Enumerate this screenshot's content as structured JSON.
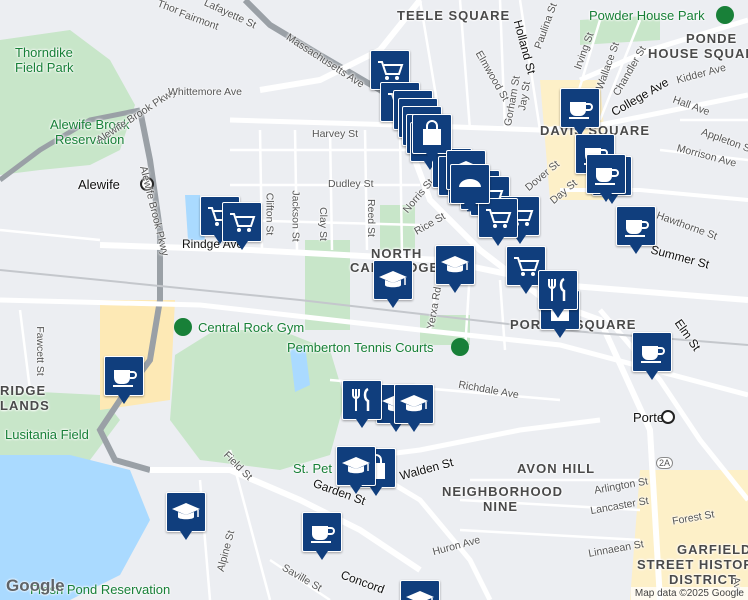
{
  "map": {
    "attribution": "Map data ©2025 Google",
    "logo": "Google",
    "colors": {
      "road": "#ffffff",
      "water": "#aadaff",
      "park": "#c8e6c9",
      "highway": "#9aa0a6",
      "pin": "#103e7d"
    }
  },
  "areas": [
    {
      "id": "teele",
      "text": "TEELE SQUARE"
    },
    {
      "id": "davis",
      "text": "DAVIS SQUARE"
    },
    {
      "id": "north",
      "text": "NORTH"
    },
    {
      "id": "cambridge",
      "text": "CAMBRIDGE"
    },
    {
      "id": "porter",
      "text": "PORTER SQUARE"
    },
    {
      "id": "avon",
      "text": "AVON HILL"
    },
    {
      "id": "neigh1",
      "text": "NEIGHBORHOOD"
    },
    {
      "id": "neigh2",
      "text": "NINE"
    },
    {
      "id": "garfield1",
      "text": "GARFIELD"
    },
    {
      "id": "garfield2",
      "text": "STREET HISTORIC"
    },
    {
      "id": "garfield3",
      "text": "DISTRICT"
    },
    {
      "id": "ponder1",
      "text": "PONDE"
    },
    {
      "id": "ponder2",
      "text": "HOUSE SQUARE"
    },
    {
      "id": "cridge",
      "text": "RIDGE"
    },
    {
      "id": "clands",
      "text": "LANDS"
    }
  ],
  "pois": [
    {
      "id": "thorndike1",
      "text": "Thorndike"
    },
    {
      "id": "thorndike2",
      "text": "Field Park"
    },
    {
      "id": "alewife_res1",
      "text": "Alewife Brook"
    },
    {
      "id": "alewife_res2",
      "text": "Reservation"
    },
    {
      "id": "alewife",
      "text": "Alewife"
    },
    {
      "id": "powder",
      "text": "Powder House Park"
    },
    {
      "id": "rock",
      "text": "Central Rock Gym"
    },
    {
      "id": "tennis",
      "text": "Pemberton Tennis Courts"
    },
    {
      "id": "lusitania",
      "text": "Lusitania Field"
    },
    {
      "id": "stpeter",
      "text": "St. Pet"
    },
    {
      "id": "porterT",
      "text": "Porter"
    },
    {
      "id": "fresh",
      "text": "Fresh Pond Reservation"
    }
  ],
  "streets": [
    {
      "id": "s1",
      "text": "Massachusetts Ave"
    },
    {
      "id": "s2",
      "text": "Alewife Brook Pkwy"
    },
    {
      "id": "s3",
      "text": "Whittemore Ave"
    },
    {
      "id": "s4",
      "text": "Harvey St"
    },
    {
      "id": "s5",
      "text": "Dudley St"
    },
    {
      "id": "s6",
      "text": "Rindge Ave"
    },
    {
      "id": "s7",
      "text": "Clifton St"
    },
    {
      "id": "s8",
      "text": "Jackson St"
    },
    {
      "id": "s9",
      "text": "Clay St"
    },
    {
      "id": "s10",
      "text": "Reed St"
    },
    {
      "id": "s11",
      "text": "Norris St"
    },
    {
      "id": "s12",
      "text": "Rice St"
    },
    {
      "id": "s13",
      "text": "Yerxa Rd"
    },
    {
      "id": "s14",
      "text": "Richdale Ave"
    },
    {
      "id": "s15",
      "text": "Walden St"
    },
    {
      "id": "s16",
      "text": "Garden St"
    },
    {
      "id": "s17",
      "text": "Field St"
    },
    {
      "id": "s18",
      "text": "Alpine St"
    },
    {
      "id": "s19",
      "text": "Saville St"
    },
    {
      "id": "s20",
      "text": "Concord"
    },
    {
      "id": "s21",
      "text": "Huron Ave"
    },
    {
      "id": "s22",
      "text": "Arlington St"
    },
    {
      "id": "s23",
      "text": "Lancaster St"
    },
    {
      "id": "s24",
      "text": "Forest St"
    },
    {
      "id": "s25",
      "text": "Linnaean St"
    },
    {
      "id": "s26",
      "text": "Elm St"
    },
    {
      "id": "s27",
      "text": "Holland St"
    },
    {
      "id": "s28",
      "text": "Elmwood St"
    },
    {
      "id": "s29",
      "text": "Gorham St"
    },
    {
      "id": "s30",
      "text": "Jay St"
    },
    {
      "id": "s31",
      "text": "Paulina St"
    },
    {
      "id": "s32",
      "text": "Irving St"
    },
    {
      "id": "s33",
      "text": "Wallace St"
    },
    {
      "id": "s34",
      "text": "Chandler St"
    },
    {
      "id": "s35",
      "text": "College Ave"
    },
    {
      "id": "s36",
      "text": "Kidder Ave"
    },
    {
      "id": "s37",
      "text": "Hall Ave"
    },
    {
      "id": "s38",
      "text": "Morrison Ave"
    },
    {
      "id": "s39",
      "text": "Appleton St"
    },
    {
      "id": "s40",
      "text": "Hawthorne St"
    },
    {
      "id": "s41",
      "text": "Dover St"
    },
    {
      "id": "s42",
      "text": "Day St"
    },
    {
      "id": "s43",
      "text": "Fawcett St"
    },
    {
      "id": "s44",
      "text": "Lafayette St"
    },
    {
      "id": "s45",
      "text": "Fairmont"
    },
    {
      "id": "s46",
      "text": "Thor"
    },
    {
      "id": "s47",
      "text": "Ave"
    },
    {
      "id": "s48",
      "text": "Summer St"
    }
  ],
  "route_shield": "2A",
  "markers": [
    {
      "type": "cart"
    },
    {
      "type": "cart"
    },
    {
      "type": "cart"
    },
    {
      "type": "cart"
    },
    {
      "type": "cart"
    },
    {
      "type": "cart"
    },
    {
      "type": "cart"
    },
    {
      "type": "cart"
    },
    {
      "type": "cart"
    },
    {
      "type": "cart"
    },
    {
      "type": "cart"
    },
    {
      "type": "cart"
    },
    {
      "type": "cart"
    },
    {
      "type": "cart"
    },
    {
      "type": "cart"
    },
    {
      "type": "cart"
    },
    {
      "type": "cart"
    },
    {
      "type": "bag"
    },
    {
      "type": "bag"
    },
    {
      "type": "bag"
    },
    {
      "type": "coffee"
    },
    {
      "type": "coffee"
    },
    {
      "type": "coffee"
    },
    {
      "type": "coffee"
    },
    {
      "type": "coffee"
    },
    {
      "type": "coffee"
    },
    {
      "type": "coffee"
    },
    {
      "type": "coffee"
    },
    {
      "type": "school"
    },
    {
      "type": "school"
    },
    {
      "type": "school"
    },
    {
      "type": "school"
    },
    {
      "type": "school"
    },
    {
      "type": "school"
    },
    {
      "type": "school"
    },
    {
      "type": "school"
    },
    {
      "type": "food"
    },
    {
      "type": "food"
    },
    {
      "type": "bakery"
    }
  ]
}
